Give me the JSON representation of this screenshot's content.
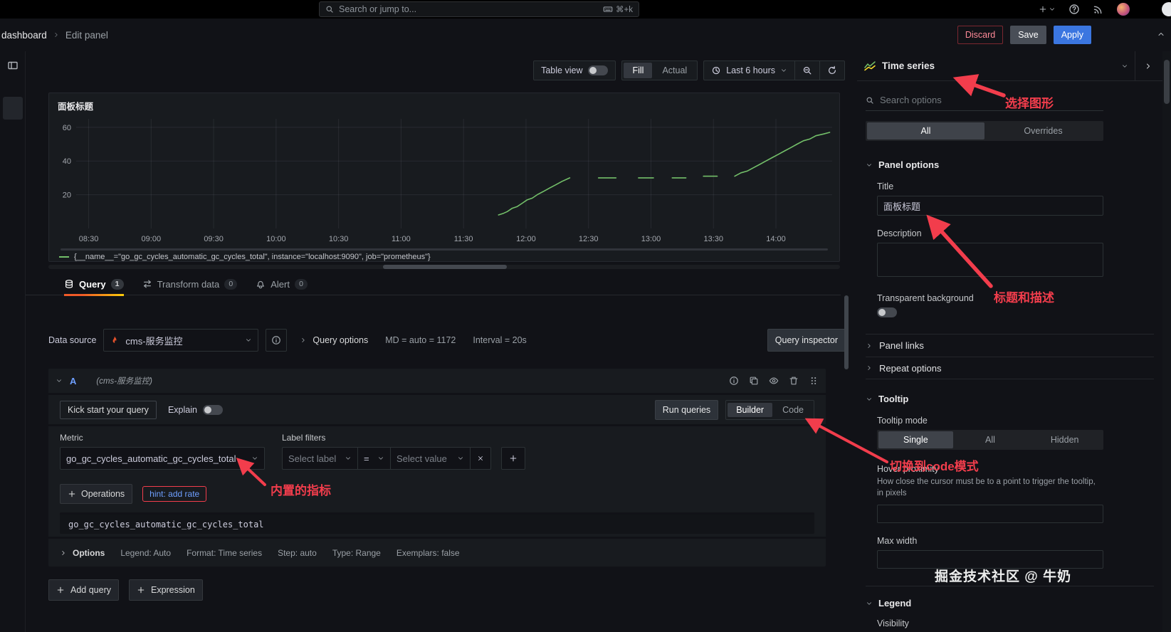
{
  "colors": {
    "background": "#111217",
    "panel": "#181b1f",
    "accent_blue": "#3b76e0",
    "link_blue": "#6e9fff",
    "annotation_red": "#f23d4c",
    "series_green": "#73bf69",
    "tab_gradient": [
      "#f05a28",
      "#fbca0a"
    ],
    "prometheus_orange": "#e6522c"
  },
  "topbar": {
    "search_placeholder": "Search or jump to...",
    "shortcut": "⌘+k"
  },
  "breadcrumb": {
    "root": "dashboard",
    "current": "Edit panel"
  },
  "header_actions": {
    "discard": "Discard",
    "save": "Save",
    "apply": "Apply"
  },
  "viz_toolbar": {
    "table_view": "Table view",
    "fill": "Fill",
    "actual": "Actual",
    "time_range": "Last 6 hours"
  },
  "panel": {
    "title": "面板标题",
    "legend_item": "{__name__=\"go_gc_cycles_automatic_gc_cycles_total\", instance=\"localhost:9090\", job=\"prometheus\"}"
  },
  "chart_data": {
    "type": "line",
    "title": "面板标题",
    "xlabel": "",
    "ylabel": "",
    "x_range": [
      8.4,
      14.45
    ],
    "y_range": [
      0,
      65
    ],
    "y_ticks": [
      20,
      40,
      60
    ],
    "x_ticks": [
      {
        "v": 8.5,
        "label": "08:30"
      },
      {
        "v": 9,
        "label": "09:00"
      },
      {
        "v": 9.5,
        "label": "09:30"
      },
      {
        "v": 10,
        "label": "10:00"
      },
      {
        "v": 10.5,
        "label": "10:30"
      },
      {
        "v": 11,
        "label": "11:00"
      },
      {
        "v": 11.5,
        "label": "11:30"
      },
      {
        "v": 12,
        "label": "12:00"
      },
      {
        "v": 12.5,
        "label": "12:30"
      },
      {
        "v": 13,
        "label": "13:00"
      },
      {
        "v": 13.5,
        "label": "13:30"
      },
      {
        "v": 14,
        "label": "14:00"
      }
    ],
    "grid": true,
    "legend_position": "bottom",
    "series": [
      {
        "name": "{__name__=\"go_gc_cycles_automatic_gc_cycles_total\", instance=\"localhost:9090\", job=\"prometheus\"}",
        "color": "#73bf69",
        "segments": [
          [
            [
              11.78,
              8
            ],
            [
              11.82,
              9
            ],
            [
              11.85,
              10
            ],
            [
              11.89,
              12
            ],
            [
              11.93,
              13
            ],
            [
              11.97,
              15
            ],
            [
              12.01,
              17
            ],
            [
              12.05,
              18
            ],
            [
              12.09,
              20
            ],
            [
              12.14,
              22
            ],
            [
              12.19,
              24
            ],
            [
              12.24,
              26
            ],
            [
              12.29,
              28
            ],
            [
              12.35,
              30
            ]
          ],
          [
            [
              12.58,
              30
            ],
            [
              12.72,
              30
            ]
          ],
          [
            [
              12.9,
              30
            ],
            [
              13.02,
              30
            ]
          ],
          [
            [
              13.17,
              30
            ],
            [
              13.28,
              30
            ]
          ],
          [
            [
              13.42,
              31
            ],
            [
              13.53,
              31
            ]
          ],
          [
            [
              13.67,
              31
            ],
            [
              13.72,
              33
            ],
            [
              13.77,
              34
            ],
            [
              13.82,
              36
            ],
            [
              13.87,
              38
            ],
            [
              13.92,
              40
            ],
            [
              13.97,
              42
            ],
            [
              14.02,
              44
            ],
            [
              14.07,
              46
            ],
            [
              14.12,
              48
            ],
            [
              14.17,
              50
            ],
            [
              14.22,
              52
            ],
            [
              14.27,
              53
            ],
            [
              14.32,
              55
            ],
            [
              14.38,
              56
            ],
            [
              14.43,
              57
            ]
          ]
        ]
      }
    ]
  },
  "tabs": {
    "query": "Query",
    "query_count": "1",
    "transform": "Transform data",
    "transform_count": "0",
    "alert": "Alert",
    "alert_count": "0"
  },
  "datasource": {
    "label": "Data source",
    "name": "cms-服务监控",
    "query_options_label": "Query options",
    "md_info": "MD = auto = 1172",
    "interval_info": "Interval = 20s",
    "inspector": "Query inspector"
  },
  "query_editor": {
    "ref_id": "A",
    "ds_hint": "(cms-服务监控)",
    "kick_start": "Kick start your query",
    "explain": "Explain",
    "run_queries": "Run queries",
    "builder": "Builder",
    "code": "Code",
    "metric_label": "Metric",
    "metric_value": "go_gc_cycles_automatic_gc_cycles_total",
    "label_filters_label": "Label filters",
    "select_label_placeholder": "Select label",
    "operator": "=",
    "select_value_placeholder": "Select value",
    "operations": "Operations",
    "hint": "hint: add rate",
    "raw_query": "go_gc_cycles_automatic_gc_cycles_total",
    "options_label": "Options",
    "opts": [
      "Legend: Auto",
      "Format: Time series",
      "Step: auto",
      "Type: Range",
      "Exemplars: false"
    ],
    "add_query": "Add query",
    "expression": "Expression"
  },
  "options_pane": {
    "viz_type": "Time series",
    "search_placeholder": "Search options",
    "tab_all": "All",
    "tab_overrides": "Overrides",
    "panel_options": "Panel options",
    "title_label": "Title",
    "title_value": "面板标题",
    "description_label": "Description",
    "transparent_bg_label": "Transparent background",
    "panel_links": "Panel links",
    "repeat_options": "Repeat options",
    "tooltip_section": "Tooltip",
    "tooltip_mode_label": "Tooltip mode",
    "mode_single": "Single",
    "mode_all": "All",
    "mode_hidden": "Hidden",
    "hover_proximity_label": "Hover proximity",
    "hover_proximity_desc": "How close the cursor must be to a point to trigger the tooltip, in pixels",
    "max_width_label": "Max width",
    "legend_section": "Legend",
    "visibility_label": "Visibility"
  },
  "watermark": "掘金技术社区 @ 牛奶",
  "annotations": {
    "pick_viz": "选择图形",
    "title_desc": "标题和描述",
    "switch_code": "切换到code模式",
    "builtin_metric": "内置的指标"
  }
}
